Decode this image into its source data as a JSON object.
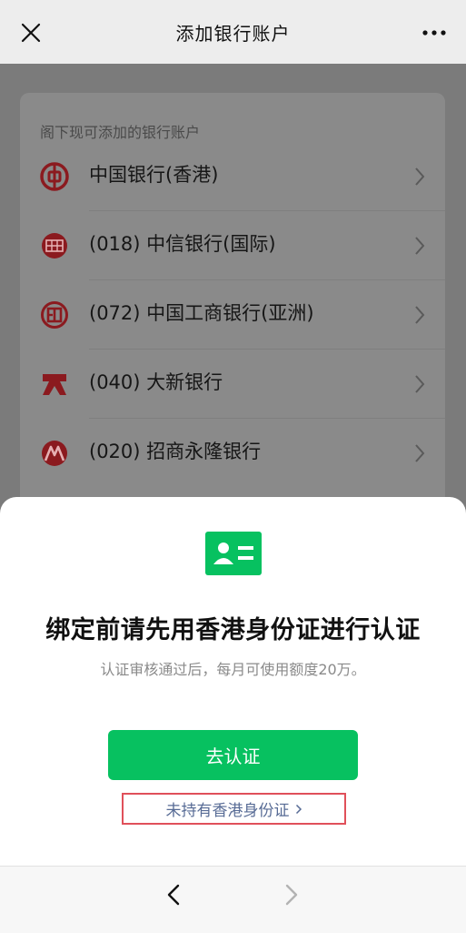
{
  "navbar": {
    "title": "添加银行账户"
  },
  "section_label": "阁下现可添加的银行账户",
  "banks": [
    {
      "name": "中国银行(香港)",
      "logo": "boc-logo-icon"
    },
    {
      "name": "(018) 中信银行(国际)",
      "logo": "citic-logo-icon"
    },
    {
      "name": "(072) 中国工商银行(亚洲)",
      "logo": "icbc-logo-icon"
    },
    {
      "name": "(040) 大新银行",
      "logo": "dahsing-logo-icon"
    },
    {
      "name": "(020) 招商永隆银行",
      "logo": "cmbwinglung-logo-icon"
    }
  ],
  "sheet": {
    "heading": "绑定前请先用香港身份证进行认证",
    "subtext": "认证审核通过后，每月可使用额度20万。",
    "primary_label": "去认证",
    "link_label": "未持有香港身份证"
  },
  "colors": {
    "accent": "#07c160",
    "link": "#576b95",
    "highlight_border": "#e0505a",
    "bank_red": "#8b1a1f"
  }
}
